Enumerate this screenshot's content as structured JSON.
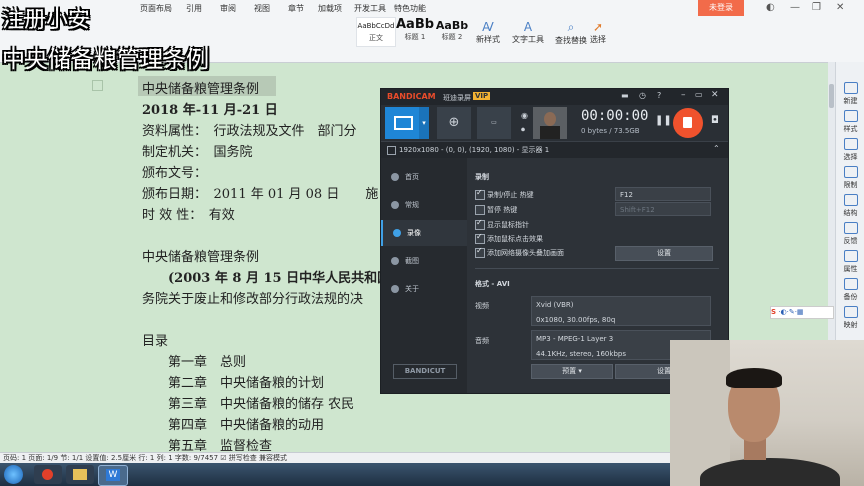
{
  "overlay": {
    "line1": "注册小安",
    "line2": "中央储备粮管理条例"
  },
  "ribbon": {
    "tabs": [
      "页面布局",
      "引用",
      "审阅",
      "视图",
      "章节",
      "加载项",
      "开发工具",
      "特色功能"
    ],
    "login": "未登录",
    "styles": [
      {
        "preview": "AaBbCcDd",
        "name": "正文"
      },
      {
        "preview": "AaBb",
        "name": "标题 1"
      },
      {
        "preview": "AaBb",
        "name": "标题 2"
      }
    ],
    "tools": [
      "新样式",
      "文字工具",
      "查找替换",
      "选择"
    ]
  },
  "document": {
    "lines": [
      "中央储备粮管理条例",
      "2018 年-11 月-21 日",
      "资料属性：　行政法规及文件　部门分",
      "制定机关：　国务院",
      "颁布文号：",
      "颁布日期：　2011 年 01 月 08 日　　施",
      "时 效 性：　有效",
      "",
      "中央储备粮管理条例",
      "　　(2003 年 8 月 15 日中华人民共和国",
      "务院关于废止和修改部分行政法规的决",
      "",
      "目录",
      "　　第一章　总则",
      "　　第二章　中央储备粮的计划",
      "　　第三章　中央储备粮的储存 农民",
      "　　第四章　中央储备粮的动用",
      "　　第五章　监督检查"
    ]
  },
  "sidebar": {
    "items": [
      "新建",
      "样式",
      "选择",
      "限制",
      "结构",
      "反馈",
      "属性",
      "备份",
      "映射"
    ]
  },
  "statusbar": {
    "text": "页码: 1  页面: 1/9  节: 1/1  设置值: 2.5厘米  行: 1  列: 1  字数: 9/7457  ☑ 拼写检查  兼容模式"
  },
  "bandicam": {
    "logo": "BANDICAM",
    "unregistered": "班迪录屏",
    "vip": "VIP",
    "timer": "00:00:00",
    "size": "0 bytes / 73.5GB",
    "resolution_line": "1920x1080 - (0, 0), (1920, 1080) - 显示器 1",
    "nav": [
      "首页",
      "常规",
      "录像",
      "截图",
      "关于"
    ],
    "active_nav": "录像",
    "cut_logo": "BANDICUT",
    "record_section": "录制",
    "options": [
      {
        "label": "录制/停止 热键",
        "checked": true
      },
      {
        "label": "暂停 热键",
        "checked": false
      },
      {
        "label": "显示鼠标指针",
        "checked": true
      },
      {
        "label": "添加鼠标点击效果",
        "checked": true
      },
      {
        "label": "添加网络摄像头叠加画面",
        "checked": true
      }
    ],
    "hotkey_record": "F12",
    "hotkey_pause": "Shift+F12",
    "settings_btn": "设置",
    "format_section": "格式 - AVI",
    "video_label": "视频",
    "video_codec": "Xvid (VBR)",
    "video_detail": "0x1080, 30.00fps, 80q",
    "audio_label": "音频",
    "audio_codec": "MP3 - MPEG-1 Layer 3",
    "audio_detail": "44.1KHz, stereo, 160kbps",
    "preset_btn": "预置",
    "settings_btn2": "设置"
  },
  "colors": {
    "accent": "#3fa0e6",
    "record": "#f0522d",
    "login": "#f26b4a"
  }
}
